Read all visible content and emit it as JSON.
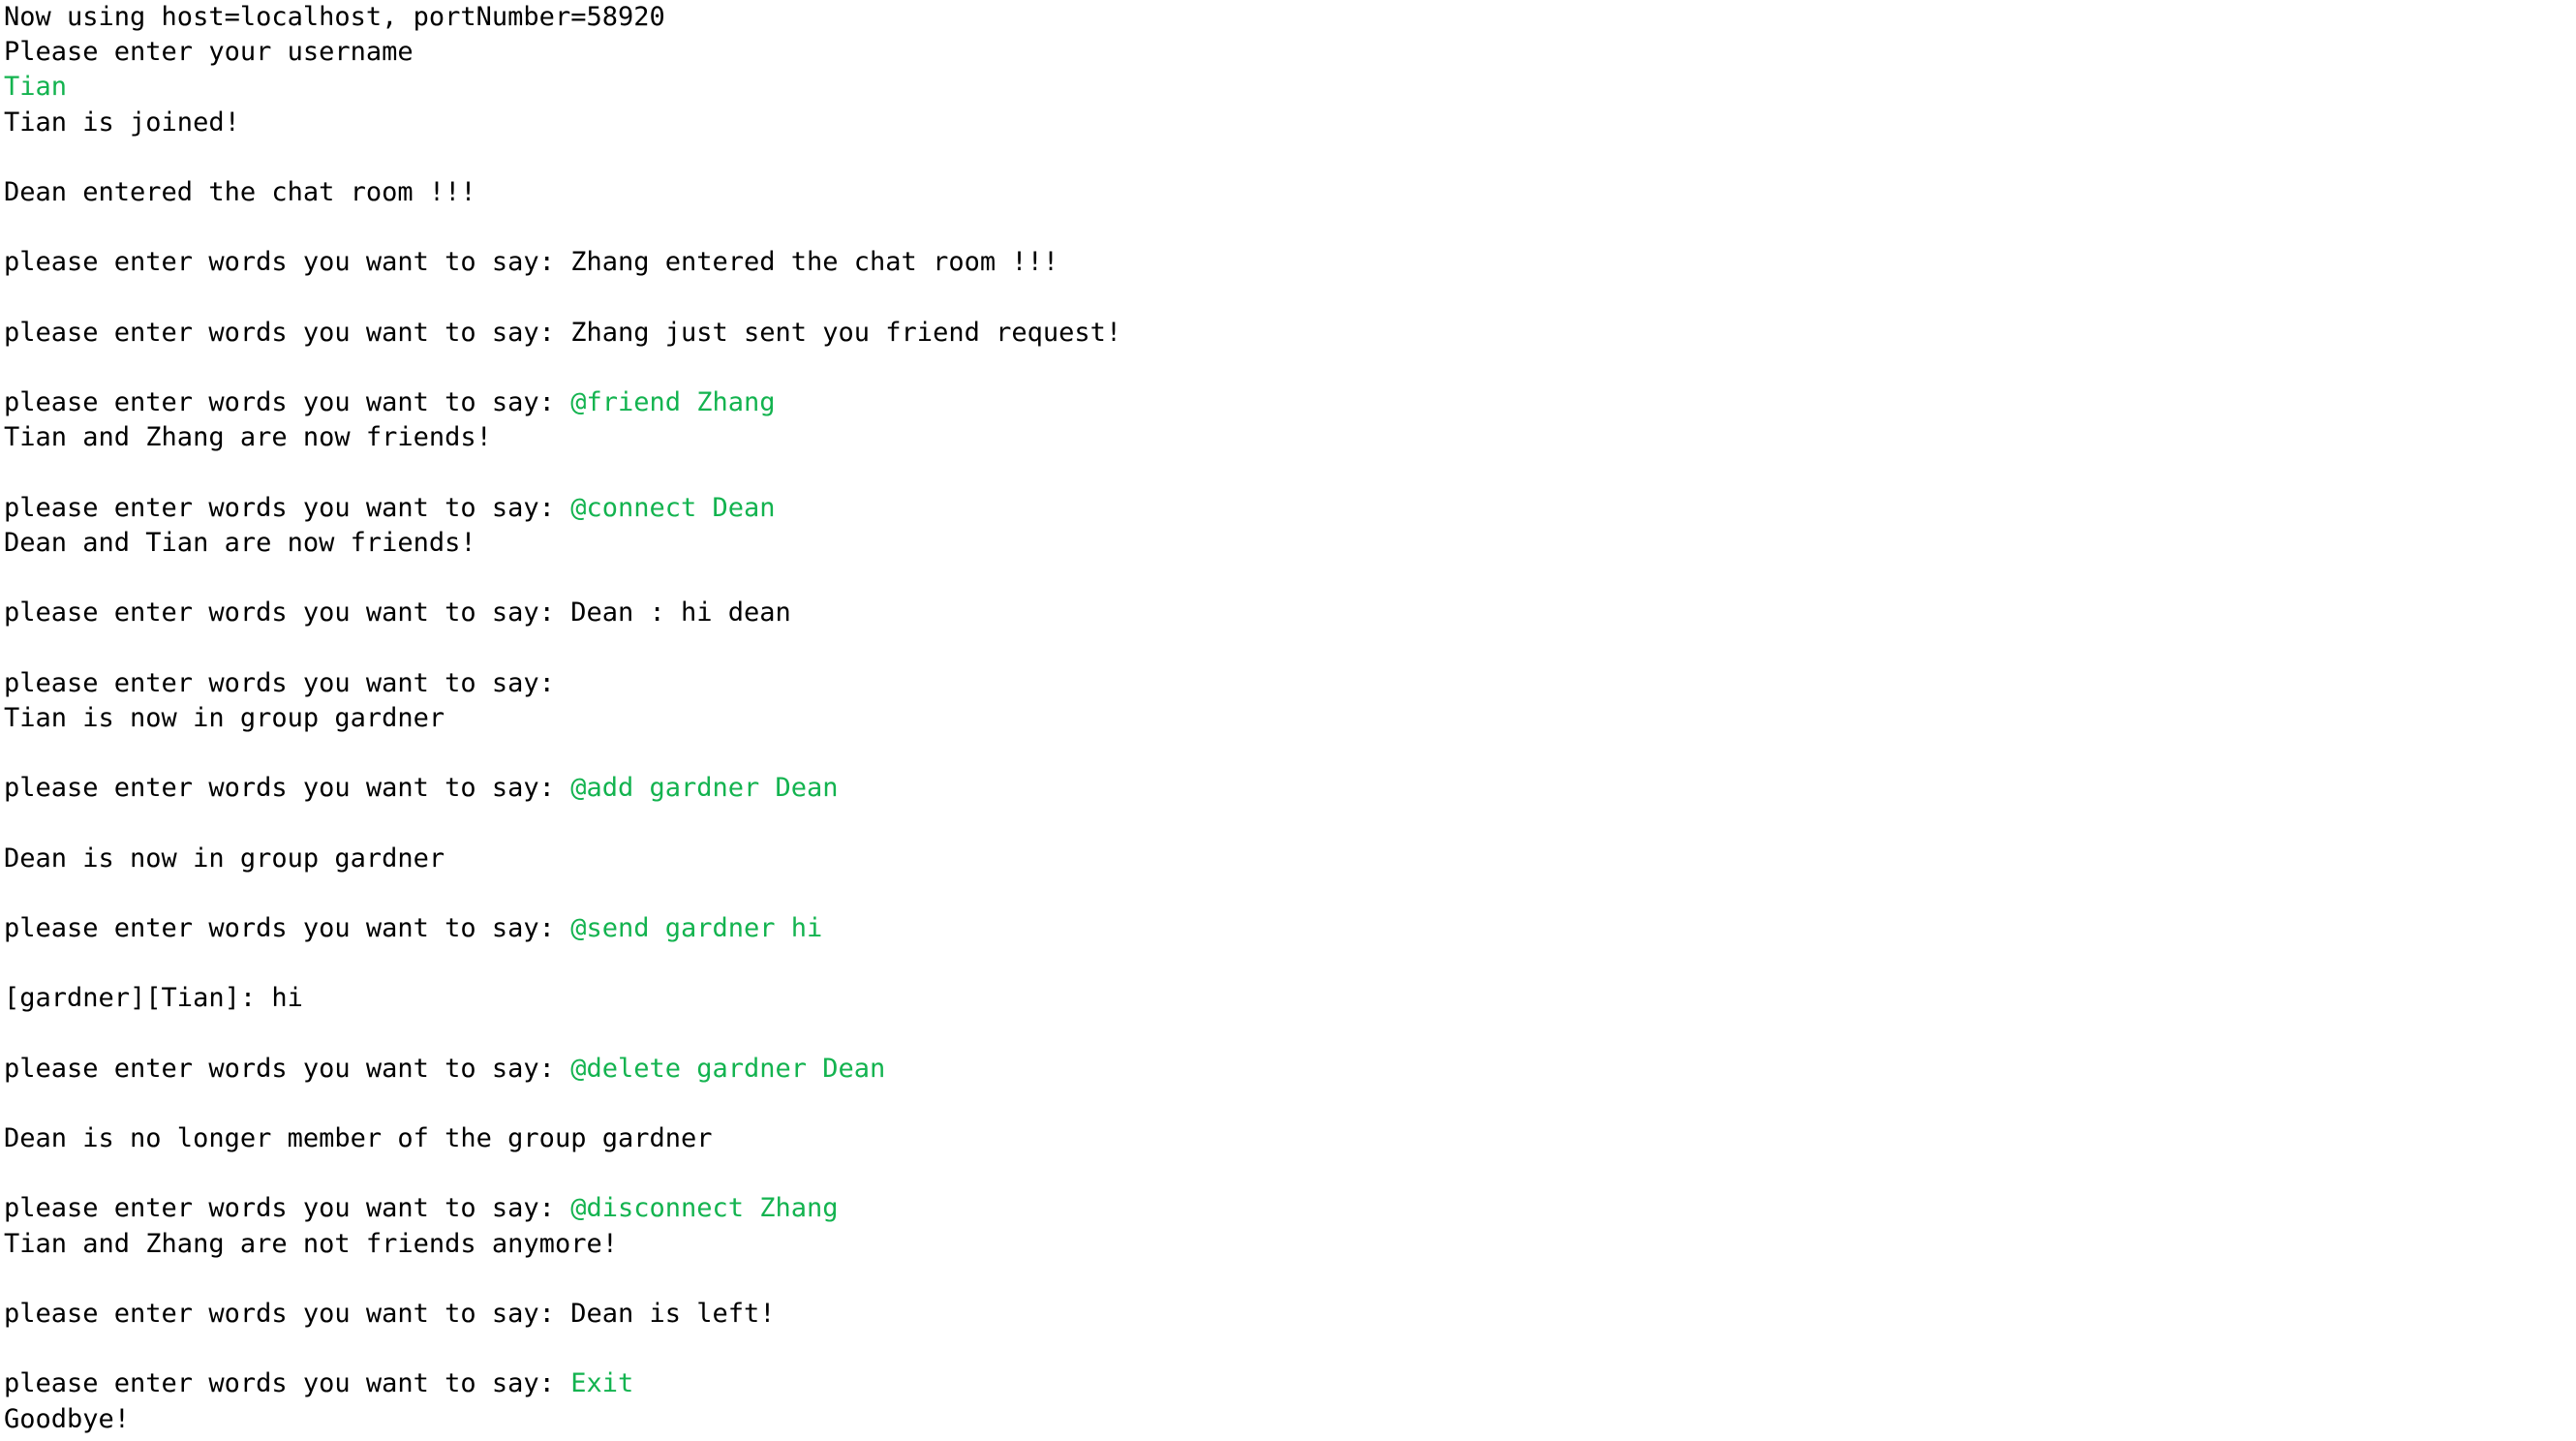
{
  "colors": {
    "background": "#ffffff",
    "text": "#000000",
    "input": "#13b34f"
  },
  "lines": [
    [
      {
        "text": "Now using host=localhost, portNumber=58920"
      }
    ],
    [
      {
        "text": "Please enter your username"
      }
    ],
    [
      {
        "text": "Tian",
        "input": true
      }
    ],
    [
      {
        "text": "Tian is joined!"
      }
    ],
    [],
    [
      {
        "text": "Dean entered the chat room !!!"
      }
    ],
    [],
    [
      {
        "text": "please enter words you want to say: Zhang entered the chat room !!!"
      }
    ],
    [],
    [
      {
        "text": "please enter words you want to say: Zhang just sent you friend request!"
      }
    ],
    [],
    [
      {
        "text": "please enter words you want to say: "
      },
      {
        "text": "@friend Zhang",
        "input": true
      }
    ],
    [
      {
        "text": "Tian and Zhang are now friends!"
      }
    ],
    [],
    [
      {
        "text": "please enter words you want to say: "
      },
      {
        "text": "@connect Dean",
        "input": true
      }
    ],
    [
      {
        "text": "Dean and Tian are now friends!"
      }
    ],
    [],
    [
      {
        "text": "please enter words you want to say: Dean : hi dean"
      }
    ],
    [],
    [
      {
        "text": "please enter words you want to say:"
      }
    ],
    [
      {
        "text": "Tian is now in group gardner"
      }
    ],
    [],
    [
      {
        "text": "please enter words you want to say: "
      },
      {
        "text": "@add gardner Dean",
        "input": true
      }
    ],
    [],
    [
      {
        "text": "Dean is now in group gardner"
      }
    ],
    [],
    [
      {
        "text": "please enter words you want to say: "
      },
      {
        "text": "@send gardner hi",
        "input": true
      }
    ],
    [],
    [
      {
        "text": "[gardner][Tian]: hi"
      }
    ],
    [],
    [
      {
        "text": "please enter words you want to say: "
      },
      {
        "text": "@delete gardner Dean",
        "input": true
      }
    ],
    [],
    [
      {
        "text": "Dean is no longer member of the group gardner"
      }
    ],
    [],
    [
      {
        "text": "please enter words you want to say: "
      },
      {
        "text": "@disconnect Zhang",
        "input": true
      }
    ],
    [
      {
        "text": "Tian and Zhang are not friends anymore!"
      }
    ],
    [],
    [
      {
        "text": "please enter words you want to say: Dean is left!"
      }
    ],
    [],
    [
      {
        "text": "please enter words you want to say: "
      },
      {
        "text": "Exit",
        "input": true
      }
    ],
    [
      {
        "text": "Goodbye!"
      }
    ]
  ]
}
